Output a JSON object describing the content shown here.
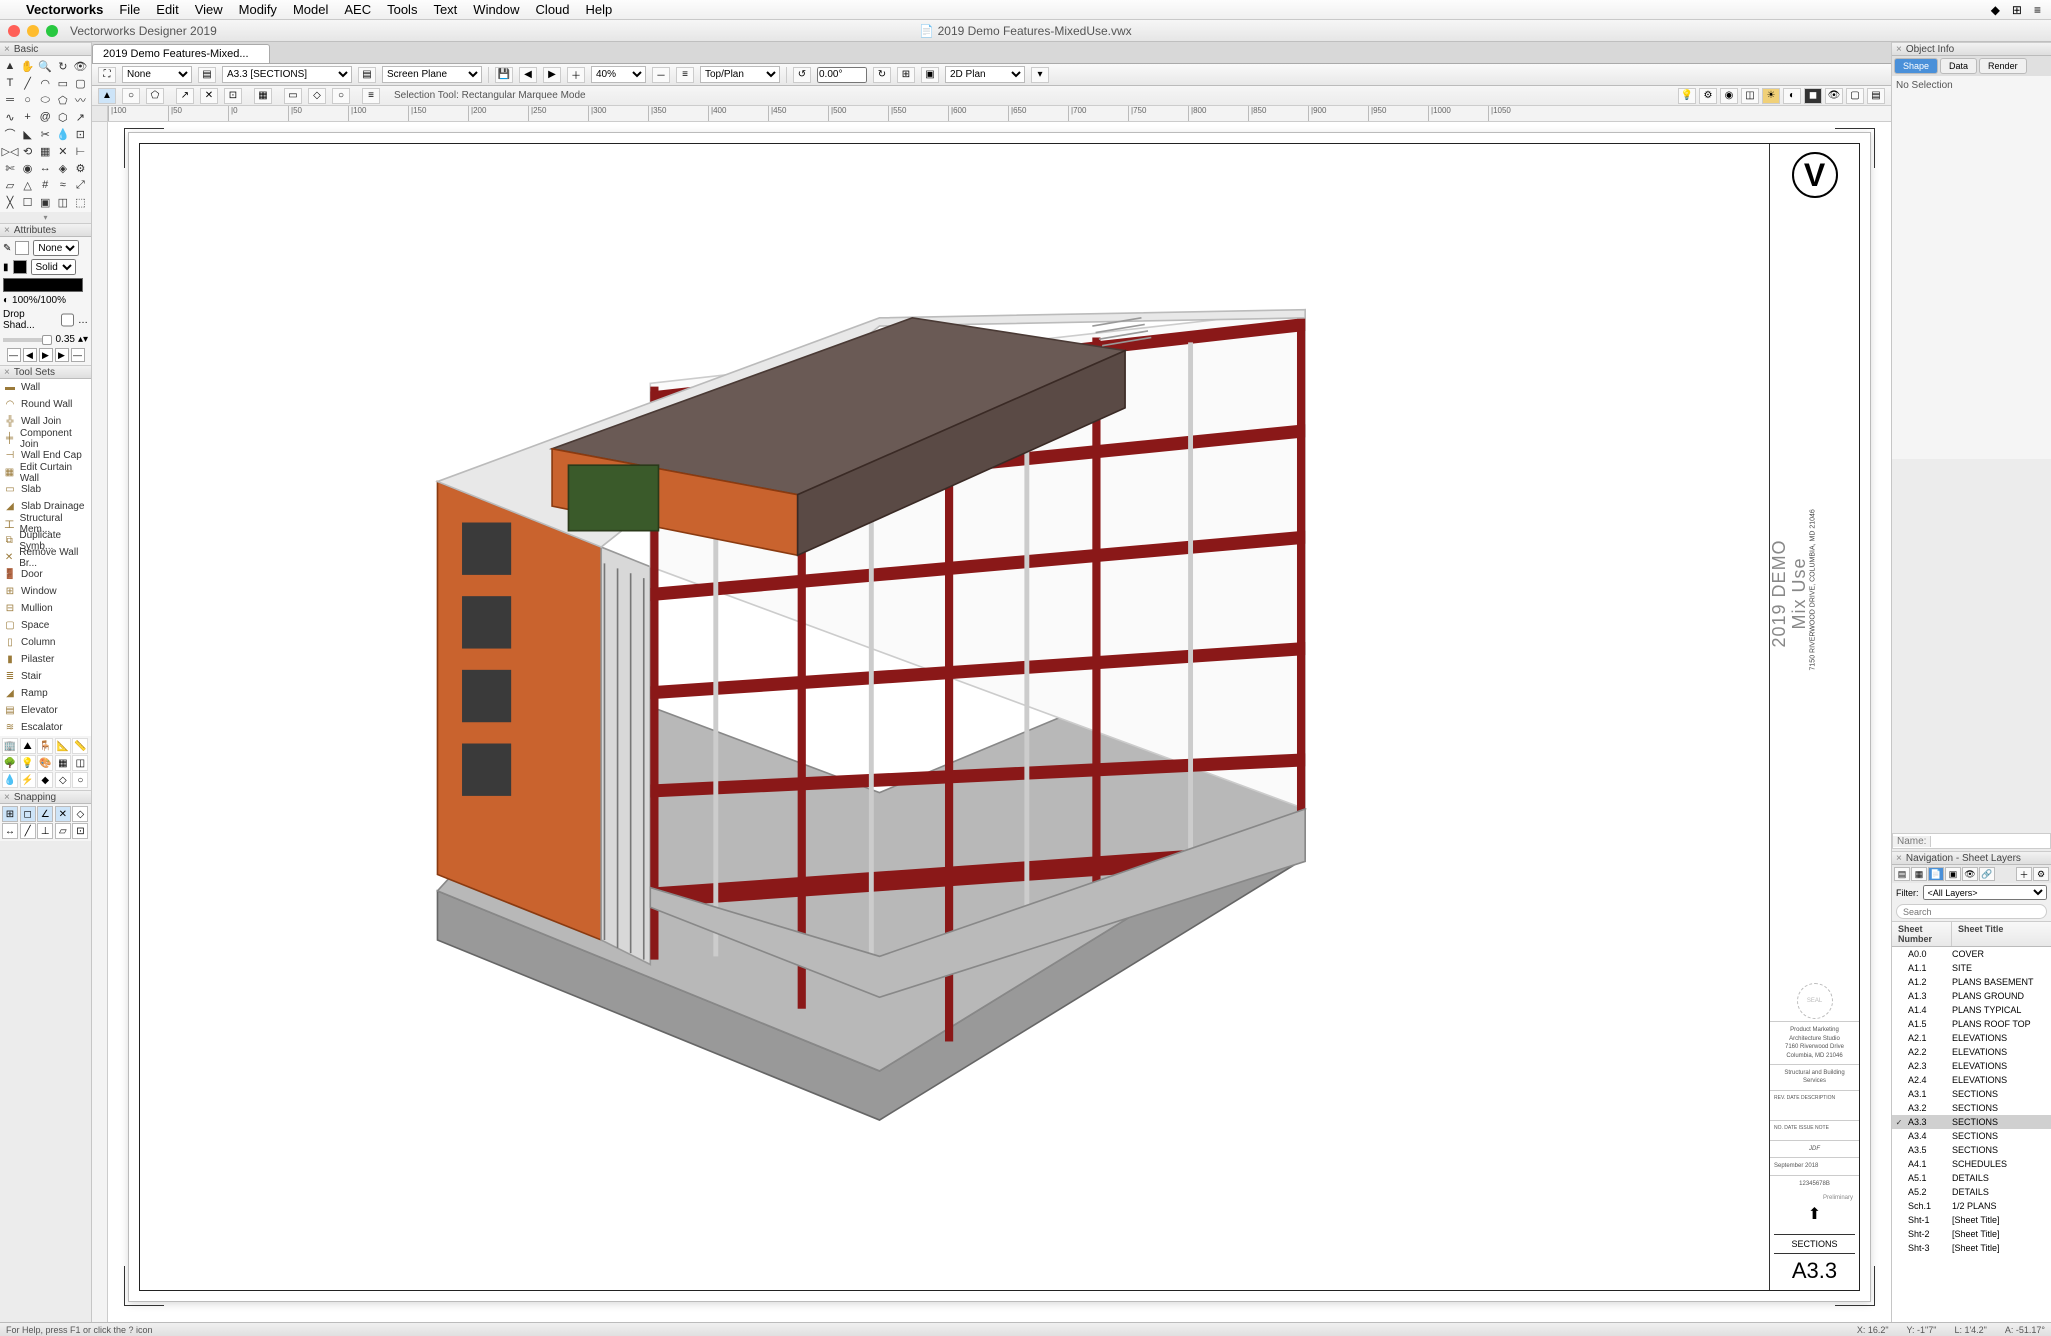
{
  "menubar": {
    "app": "Vectorworks",
    "items": [
      "File",
      "Edit",
      "View",
      "Modify",
      "Model",
      "AEC",
      "Tools",
      "Text",
      "Window",
      "Cloud",
      "Help"
    ]
  },
  "window": {
    "apptitle": "Vectorworks Designer 2019",
    "doctitle": "2019 Demo Features-MixedUse.vwx"
  },
  "doctab": "2019 Demo Features-Mixed...",
  "viewbar": {
    "class_select": "None",
    "layer_select": "A3.3 [SECTIONS]",
    "plane_select": "Screen Plane",
    "zoom": "40%",
    "view_select": "Top/Plan",
    "angle": "0.00°",
    "render_select": "2D Plan"
  },
  "modebar": {
    "text": "Selection Tool: Rectangular Marquee Mode"
  },
  "palettes": {
    "basic": "Basic",
    "attributes": "Attributes",
    "toolsets": "Tool Sets",
    "snapping": "Snapping",
    "objinfo": "Object Info",
    "navigation": "Navigation - Sheet Layers"
  },
  "attributes": {
    "stroke": "None",
    "fill": "Solid",
    "opacity": "100%/100%",
    "dropshadow": "Drop Shad...",
    "shadow_val": "0.35"
  },
  "toolsets": [
    "Wall",
    "Round Wall",
    "Wall Join",
    "Component Join",
    "Wall End Cap",
    "Edit Curtain Wall",
    "Slab",
    "Slab Drainage",
    "Structural Mem...",
    "Duplicate Symb...",
    "Remove Wall Br...",
    "Door",
    "Window",
    "Mullion",
    "Space",
    "Column",
    "Pilaster",
    "Stair",
    "Ramp",
    "Elevator",
    "Escalator"
  ],
  "objinfo": {
    "tabs": [
      "Shape",
      "Data",
      "Render"
    ],
    "noselection": "No Selection",
    "name_label": "Name:"
  },
  "navigation": {
    "filter_label": "Filter:",
    "filter_value": "<All Layers>",
    "search_placeholder": "Search",
    "col1": "Sheet Number",
    "col2": "Sheet Title",
    "active": "A3.3",
    "sheets": [
      {
        "n": "A0.0",
        "t": "COVER"
      },
      {
        "n": "A1.1",
        "t": "SITE"
      },
      {
        "n": "A1.2",
        "t": "PLANS BASEMENT"
      },
      {
        "n": "A1.3",
        "t": "PLANS GROUND"
      },
      {
        "n": "A1.4",
        "t": "PLANS TYPICAL"
      },
      {
        "n": "A1.5",
        "t": "PLANS ROOF TOP"
      },
      {
        "n": "A2.1",
        "t": "ELEVATIONS"
      },
      {
        "n": "A2.2",
        "t": "ELEVATIONS"
      },
      {
        "n": "A2.3",
        "t": "ELEVATIONS"
      },
      {
        "n": "A2.4",
        "t": "ELEVATIONS"
      },
      {
        "n": "A3.1",
        "t": "SECTIONS"
      },
      {
        "n": "A3.2",
        "t": "SECTIONS"
      },
      {
        "n": "A3.3",
        "t": "SECTIONS"
      },
      {
        "n": "A3.4",
        "t": "SECTIONS"
      },
      {
        "n": "A3.5",
        "t": "SECTIONS"
      },
      {
        "n": "A4.1",
        "t": "SCHEDULES"
      },
      {
        "n": "A5.1",
        "t": "DETAILS"
      },
      {
        "n": "A5.2",
        "t": "DETAILS"
      },
      {
        "n": "Sch.1",
        "t": "1/2 PLANS"
      },
      {
        "n": "Sht-1",
        "t": "[Sheet Title]"
      },
      {
        "n": "Sht-2",
        "t": "[Sheet Title]"
      },
      {
        "n": "Sht-3",
        "t": "[Sheet Title]"
      }
    ]
  },
  "titleblock": {
    "logo": "V",
    "project_l1": "2019 DEMO",
    "project_l2": "Mix Use",
    "address": "7150 RIVERWOOD DRIVE, COLUMBIA, MD 21046",
    "firm_l1": "Product Marketing",
    "firm_l2": "Architecture Studio",
    "firm_l3": "7160 Riverwood Drive",
    "firm_l4": "Columbia, MD 21046",
    "consult": "Structural and Building Services",
    "rev_hdr": "REV.   DATE   DESCRIPTION",
    "issue_hdr": "NO.   DATE   ISSUE NOTE",
    "stamp": "JDF",
    "date": "September 2018",
    "job": "12345678B",
    "prelim": "Preliminary",
    "sheetname": "SECTIONS",
    "sheetnum": "A3.3"
  },
  "statusbar": {
    "help": "For Help, press F1 or click the ? icon",
    "x": "X: 16.2\"",
    "y": "Y: -1\"7\"",
    "l": "L: 1'4.2\"",
    "a": "A: -51.17°"
  },
  "ruler_labels": [
    "|100",
    "|50",
    "|0",
    "|50",
    "|100",
    "|150",
    "|200",
    "|250",
    "|300",
    "|350",
    "|400",
    "|450",
    "|500",
    "|550",
    "|600",
    "|650",
    "|700",
    "|750",
    "|800",
    "|850",
    "|900",
    "|950",
    "|1000",
    "|1050"
  ]
}
